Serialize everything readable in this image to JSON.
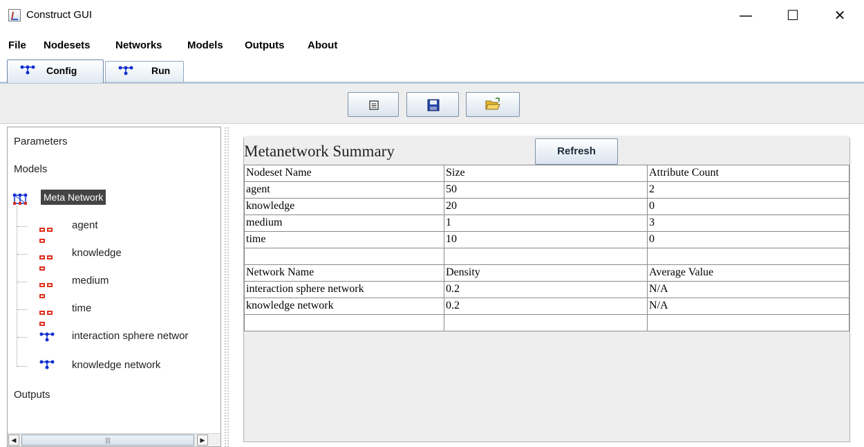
{
  "window": {
    "title": "Construct GUI",
    "minimize_glyph": "—",
    "maximize_glyph": "☐",
    "close_glyph": "✕"
  },
  "menu": [
    "File",
    "Nodesets",
    "Networks",
    "Models",
    "Outputs",
    "About"
  ],
  "tabs": [
    {
      "label": "Config",
      "icon": "network-icon",
      "active": true
    },
    {
      "label": "Run",
      "icon": "network-icon",
      "active": false
    }
  ],
  "toolbar": {
    "buttons": [
      {
        "name": "new-document-button",
        "icon": "document-icon"
      },
      {
        "name": "save-button",
        "icon": "floppy-disk-icon"
      },
      {
        "name": "open-folder-button",
        "icon": "open-folder-icon"
      }
    ]
  },
  "tree": {
    "parameters": "Parameters",
    "models": "Models",
    "meta_network": "Meta Network",
    "children": [
      {
        "label": "agent",
        "icon": "nodeset-icon"
      },
      {
        "label": "knowledge",
        "icon": "nodeset-icon"
      },
      {
        "label": "medium",
        "icon": "nodeset-icon"
      },
      {
        "label": "time",
        "icon": "nodeset-icon"
      },
      {
        "label": "interaction sphere networ",
        "icon": "network-icon"
      },
      {
        "label": "knowledge network",
        "icon": "network-icon"
      }
    ],
    "outputs": "Outputs"
  },
  "summary": {
    "title": "Metanetwork Summary",
    "refresh_label": "Refresh",
    "nodeset_headers": [
      "Nodeset Name",
      "Size",
      "Attribute Count"
    ],
    "nodesets": [
      [
        "agent",
        "50",
        "2"
      ],
      [
        "knowledge",
        "20",
        "0"
      ],
      [
        "medium",
        "1",
        "3"
      ],
      [
        "time",
        "10",
        "0"
      ]
    ],
    "network_headers": [
      "Network Name",
      "Density",
      "Average Value"
    ],
    "networks": [
      [
        "interaction sphere network",
        "0.2",
        "N/A"
      ],
      [
        "knowledge network",
        "0.2",
        "N/A"
      ]
    ]
  },
  "colors": {
    "accent": "#3366cc",
    "nodeset_icon": "#e03020",
    "network_icon": "#1030d0",
    "selection": "#444444"
  }
}
